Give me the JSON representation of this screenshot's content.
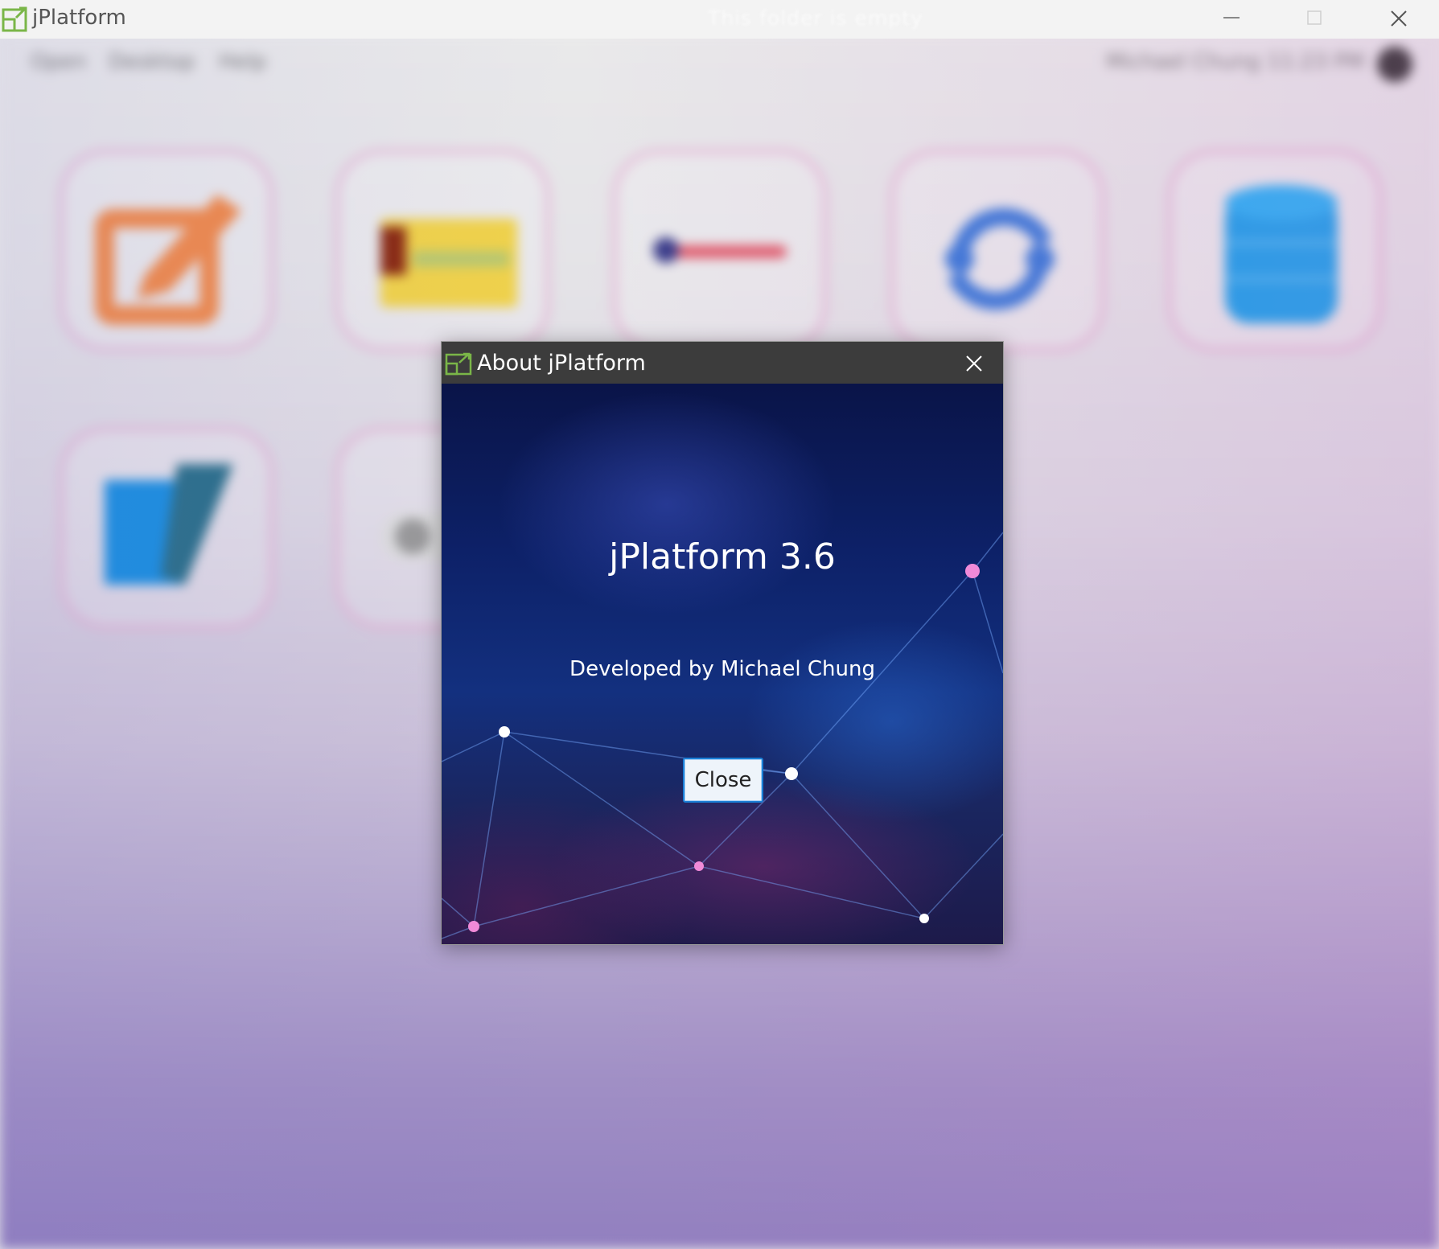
{
  "window": {
    "title": "jPlatform",
    "center_title": "This folder is empty",
    "controls": [
      "minimize",
      "maximize",
      "close"
    ]
  },
  "menubar": {
    "items": [
      "Open",
      "Desktop",
      "Help"
    ],
    "status_text": "Michael Chung  11:23 PM"
  },
  "tiles": [
    {
      "icon": "edit-icon",
      "color": "#f08a4b"
    },
    {
      "icon": "card-icon",
      "color": "#f0d24a"
    },
    {
      "icon": "slider-icon",
      "color": "#e05a6a"
    },
    {
      "icon": "sync-icon",
      "color": "#3a78d8"
    },
    {
      "icon": "database-icon",
      "color": "#1aa0ea"
    },
    {
      "icon": "script-icon",
      "color": "#1a8ee0"
    },
    {
      "icon": "toggle-icon",
      "color": "#888888"
    }
  ],
  "dialog": {
    "title": "About jPlatform",
    "heading": "jPlatform 3.6",
    "subtitle": "Developed by Michael Chung",
    "close_button": "Close"
  },
  "colors": {
    "logo": "#7ab648",
    "dialog_titlebar": "#3c3c3c",
    "button_border": "#1a7fd6"
  }
}
